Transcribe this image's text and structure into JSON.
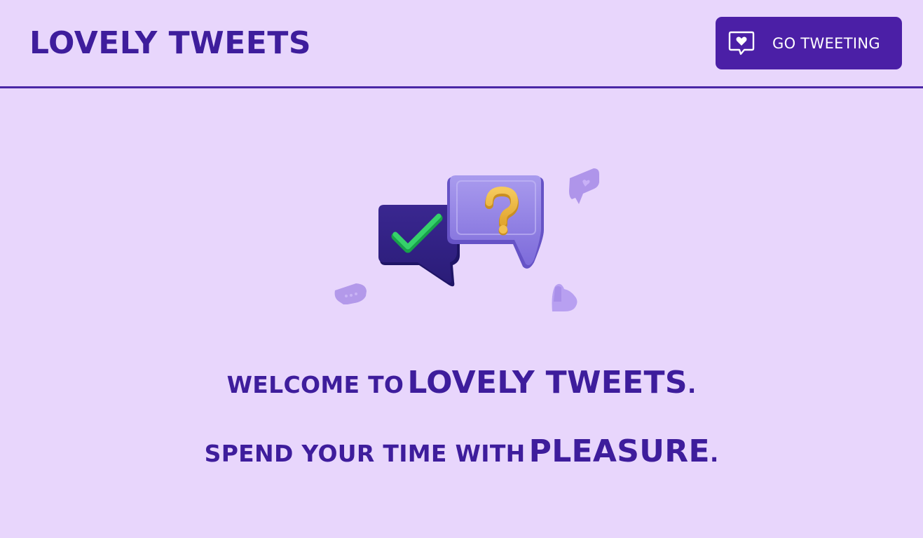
{
  "header": {
    "logo": "LOVELY TWEETS",
    "cta_label": "GO TWEETING",
    "cta_icon": "heart-chat-icon"
  },
  "hero": {
    "illustration": "chat-bubbles-illustration",
    "icons": [
      "check-icon",
      "question-mark-icon",
      "heart-icon",
      "chat-icon"
    ]
  },
  "welcome": {
    "prefix": "WELCOME TO",
    "emphasis": "LOVELY TWEETS",
    "suffix": "."
  },
  "tagline": {
    "prefix": "SPEND YOUR TIME WITH",
    "emphasis": "PLEASURE",
    "suffix": "."
  },
  "colors": {
    "background": "#E8D6FC",
    "brand": "#3E1D9C",
    "button": "#4B1FA6"
  }
}
